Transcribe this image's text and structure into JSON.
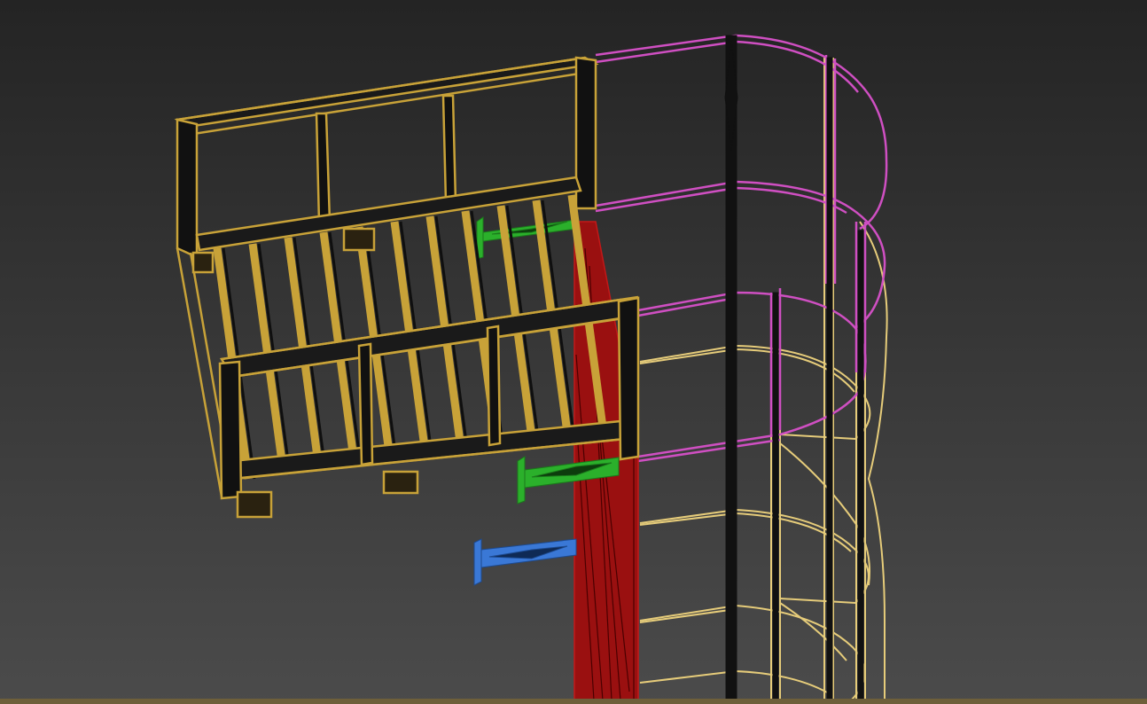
{
  "viewport": {
    "background_top": "#242424",
    "background_bottom": "#4b4b4b",
    "ground_line": "#6e5f3a"
  },
  "scene_objects": [
    {
      "name": "platform-walkway",
      "color": "#c8a238"
    },
    {
      "name": "cage-lower",
      "color": "#e6cc7a"
    },
    {
      "name": "cage-upper",
      "color": "#cf4fc2"
    },
    {
      "name": "support-post",
      "color": "#9a1010"
    },
    {
      "name": "bracket-upper",
      "color": "#2bb02b"
    },
    {
      "name": "bracket-middle",
      "color": "#2bb02b"
    },
    {
      "name": "bracket-lower",
      "color": "#3a78d6"
    },
    {
      "name": "cage-vertical-bars",
      "color": "#111111"
    }
  ]
}
